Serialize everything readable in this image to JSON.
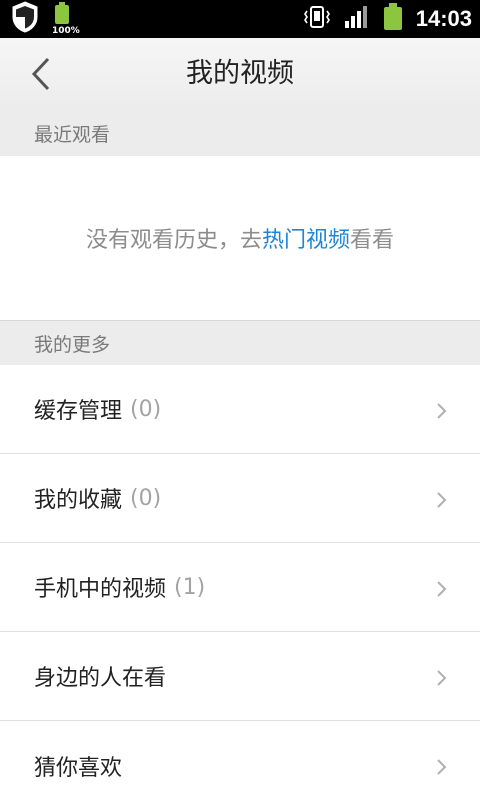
{
  "statusbar": {
    "battery_small_label": "100%",
    "time": "14:03"
  },
  "header": {
    "title": "我的视频"
  },
  "recent": {
    "title": "最近观看",
    "empty_prefix": "没有观看历史，去",
    "empty_link": "热门视频",
    "empty_suffix": "看看"
  },
  "more": {
    "title": "我的更多",
    "items": [
      {
        "label": "缓存管理",
        "count": "(0)"
      },
      {
        "label": "我的收藏",
        "count": "(0)"
      },
      {
        "label": "手机中的视频",
        "count": "(1)"
      },
      {
        "label": "身边的人在看",
        "count": ""
      },
      {
        "label": "猜你喜欢",
        "count": ""
      }
    ]
  },
  "colors": {
    "link": "#1f86d6",
    "battery": "#8cc63f"
  },
  "icons": [
    "shield-icon",
    "battery-icon",
    "vibrate-icon",
    "signal-icon",
    "chevron-left-icon",
    "chevron-right-icon"
  ]
}
